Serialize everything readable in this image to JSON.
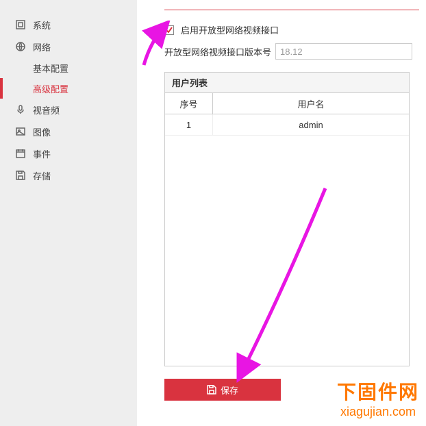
{
  "sidebar": {
    "items": [
      {
        "label": "系统",
        "icon": "system"
      },
      {
        "label": "网络",
        "icon": "network",
        "children": [
          {
            "label": "基本配置",
            "active": false
          },
          {
            "label": "高级配置",
            "active": true
          }
        ]
      },
      {
        "label": "视音频",
        "icon": "av"
      },
      {
        "label": "图像",
        "icon": "image"
      },
      {
        "label": "事件",
        "icon": "event"
      },
      {
        "label": "存储",
        "icon": "storage"
      }
    ]
  },
  "main": {
    "enable_checkbox": {
      "checked": true,
      "label": "启用开放型网络视频接口"
    },
    "version": {
      "label": "开放型网络视频接口版本号",
      "value": "18.12"
    },
    "table": {
      "title": "用户列表",
      "columns": {
        "seq": "序号",
        "user": "用户名"
      },
      "rows": [
        {
          "seq": "1",
          "user": "admin"
        }
      ]
    },
    "save_label": "保存"
  },
  "watermark": {
    "cn": "下固件网",
    "en": "xiagujian.com"
  }
}
